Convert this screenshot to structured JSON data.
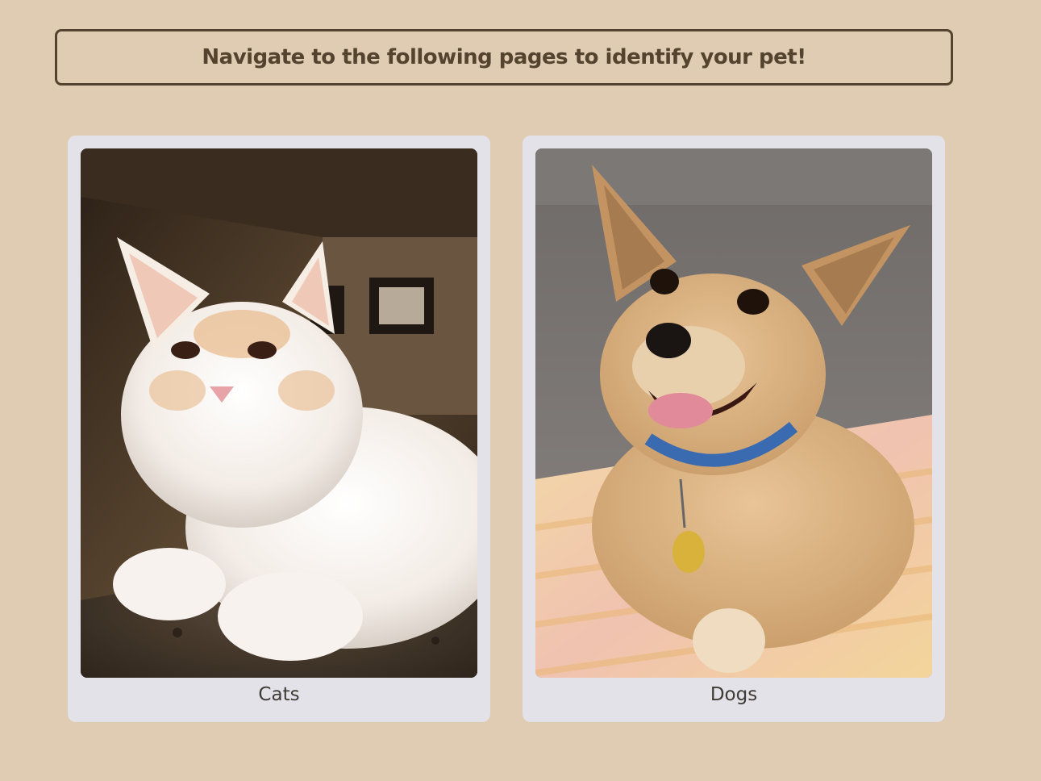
{
  "header": {
    "text": "Navigate to the following pages to identify your pet!"
  },
  "cards": [
    {
      "label": "Cats",
      "image": "white-cat-photo"
    },
    {
      "label": "Dogs",
      "image": "tan-dog-photo"
    }
  ]
}
